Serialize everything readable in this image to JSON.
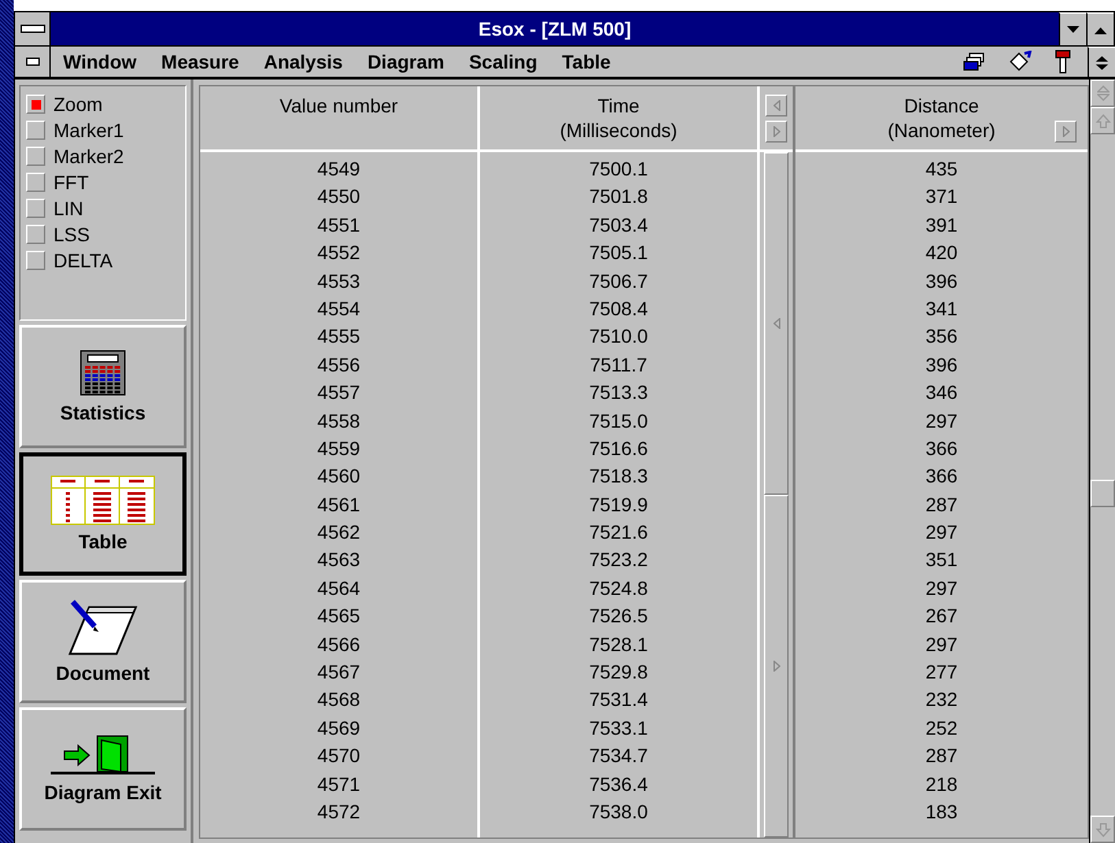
{
  "window": {
    "title": "Esox - [ZLM 500]"
  },
  "menu": [
    {
      "label": "Window"
    },
    {
      "label": "Measure"
    },
    {
      "label": "Analysis"
    },
    {
      "label": "Diagram"
    },
    {
      "label": "Scaling"
    },
    {
      "label": "Table"
    }
  ],
  "options": [
    {
      "label": "Zoom",
      "checked": true
    },
    {
      "label": "Marker1",
      "checked": false
    },
    {
      "label": "Marker2",
      "checked": false
    },
    {
      "label": "FFT",
      "checked": false
    },
    {
      "label": "LIN",
      "checked": false
    },
    {
      "label": "LSS",
      "checked": false
    },
    {
      "label": "DELTA",
      "checked": false
    }
  ],
  "nav": [
    {
      "kind": "statistics",
      "label": "Statistics",
      "selected": false
    },
    {
      "kind": "table",
      "label": "Table",
      "selected": true
    },
    {
      "kind": "document",
      "label": "Document",
      "selected": false
    },
    {
      "kind": "exit",
      "label": "Diagram Exit",
      "selected": false
    }
  ],
  "table": {
    "columns": [
      {
        "title": "Value number"
      },
      {
        "title": "Time",
        "unit": "(Milliseconds)"
      },
      {
        "title": "Distance",
        "unit": "(Nanometer)"
      }
    ],
    "rows": [
      [
        "4549",
        "7500.1",
        "435"
      ],
      [
        "4550",
        "7501.8",
        "371"
      ],
      [
        "4551",
        "7503.4",
        "391"
      ],
      [
        "4552",
        "7505.1",
        "420"
      ],
      [
        "4553",
        "7506.7",
        "396"
      ],
      [
        "4554",
        "7508.4",
        "341"
      ],
      [
        "4555",
        "7510.0",
        "356"
      ],
      [
        "4556",
        "7511.7",
        "396"
      ],
      [
        "4557",
        "7513.3",
        "346"
      ],
      [
        "4558",
        "7515.0",
        "297"
      ],
      [
        "4559",
        "7516.6",
        "366"
      ],
      [
        "4560",
        "7518.3",
        "366"
      ],
      [
        "4561",
        "7519.9",
        "287"
      ],
      [
        "4562",
        "7521.6",
        "297"
      ],
      [
        "4563",
        "7523.2",
        "351"
      ],
      [
        "4564",
        "7524.8",
        "297"
      ],
      [
        "4565",
        "7526.5",
        "267"
      ],
      [
        "4566",
        "7528.1",
        "297"
      ],
      [
        "4567",
        "7529.8",
        "277"
      ],
      [
        "4568",
        "7531.4",
        "232"
      ],
      [
        "4569",
        "7533.1",
        "252"
      ],
      [
        "4570",
        "7534.7",
        "287"
      ],
      [
        "4571",
        "7536.4",
        "218"
      ],
      [
        "4572",
        "7538.0",
        "183"
      ]
    ]
  }
}
